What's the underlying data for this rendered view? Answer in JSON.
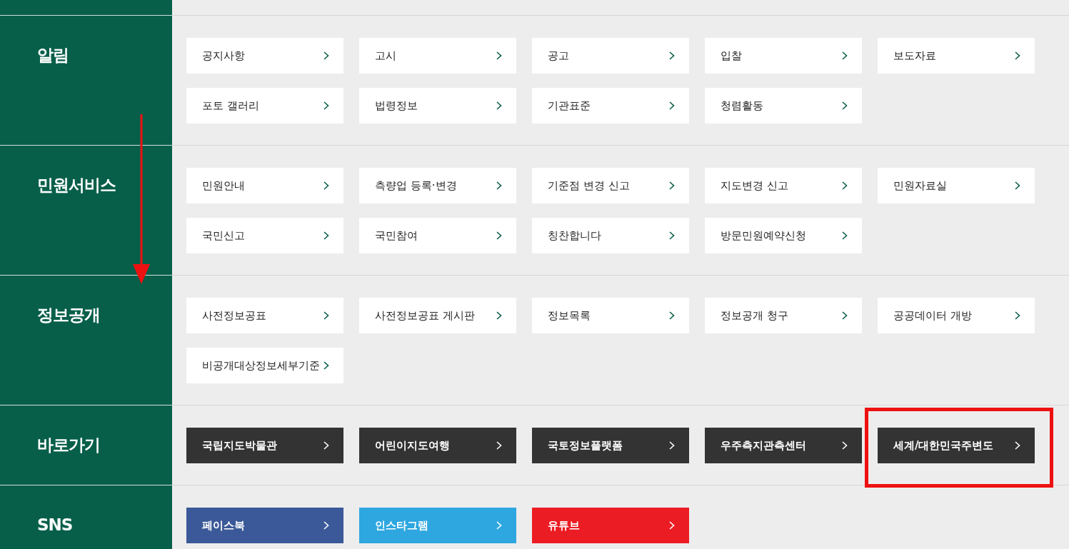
{
  "sections": [
    {
      "title": "알림",
      "kind": "light",
      "links": [
        {
          "label": "공지사항"
        },
        {
          "label": "고시"
        },
        {
          "label": "공고"
        },
        {
          "label": "입찰"
        },
        {
          "label": "보도자료"
        },
        {
          "label": "포토 갤러리"
        },
        {
          "label": "법령정보"
        },
        {
          "label": "기관표준"
        },
        {
          "label": "청렴활동"
        }
      ]
    },
    {
      "title": "민원서비스",
      "kind": "light",
      "links": [
        {
          "label": "민원안내"
        },
        {
          "label": "측량업 등록·변경"
        },
        {
          "label": "기준점 변경 신고"
        },
        {
          "label": "지도변경 신고"
        },
        {
          "label": "민원자료실"
        },
        {
          "label": "국민신고"
        },
        {
          "label": "국민참여"
        },
        {
          "label": "칭찬합니다"
        },
        {
          "label": "방문민원예약신청"
        }
      ]
    },
    {
      "title": "정보공개",
      "kind": "light",
      "links": [
        {
          "label": "사전정보공표"
        },
        {
          "label": "사전정보공표 게시판"
        },
        {
          "label": "정보목록"
        },
        {
          "label": "정보공개 청구"
        },
        {
          "label": "공공데이터 개방"
        },
        {
          "label": "비공개대상정보세부기준"
        }
      ]
    },
    {
      "title": "바로가기",
      "kind": "dark",
      "links": [
        {
          "label": "국립지도박물관",
          "highlighted": false
        },
        {
          "label": "어린이지도여행",
          "highlighted": false
        },
        {
          "label": "국토정보플랫폼",
          "highlighted": false
        },
        {
          "label": "우주측지관측센터",
          "highlighted": false
        },
        {
          "label": "세계/대한민국주변도",
          "highlighted": true
        }
      ]
    },
    {
      "title": "SNS",
      "kind": "brand",
      "links": [
        {
          "label": "페이스북",
          "color": "#3b5998"
        },
        {
          "label": "인스타그램",
          "color": "#2ea7e0"
        },
        {
          "label": "유튜브",
          "color": "#ec1c24"
        }
      ]
    }
  ]
}
